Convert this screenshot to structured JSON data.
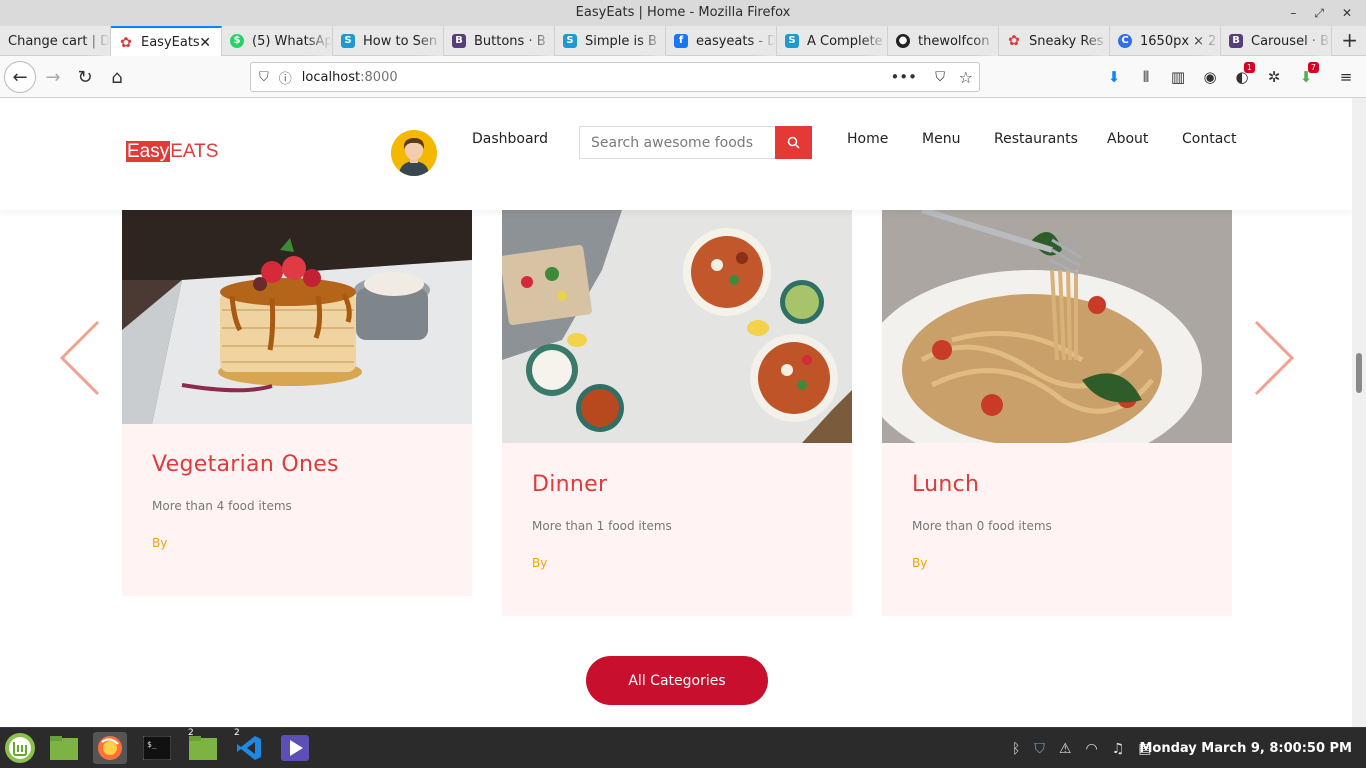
{
  "window": {
    "title": "EasyEats | Home - Mozilla Firefox"
  },
  "tabs": [
    {
      "label": "Change cart | D",
      "icon": "django-icon",
      "color": "#0c4b33"
    },
    {
      "label": "EasyEats",
      "icon": "easyeats-icon",
      "color": "#e03a3a",
      "active": true
    },
    {
      "label": "(5) WhatsAp",
      "icon": "whatsapp-icon",
      "color": "#25d366"
    },
    {
      "label": "How to Sen",
      "icon": "stackoverflow-icon",
      "color": "#1d9bd1"
    },
    {
      "label": "Buttons · B",
      "icon": "bootstrap-icon",
      "color": "#563d7c"
    },
    {
      "label": "Simple is B",
      "icon": "stackoverflow-icon",
      "color": "#1d9bd1"
    },
    {
      "label": "easyeats - D",
      "icon": "facebook-icon",
      "color": "#1877f2"
    },
    {
      "label": "A Complete",
      "icon": "stackoverflow-icon",
      "color": "#1d9bd1"
    },
    {
      "label": "thewolfcon",
      "icon": "github-icon",
      "color": "#222222"
    },
    {
      "label": "Sneaky Res",
      "icon": "easyeats-icon",
      "color": "#e03a3a"
    },
    {
      "label": "1650px × 2",
      "icon": "image-icon",
      "color": "#2f6fed"
    },
    {
      "label": "Carousel · B",
      "icon": "bootstrap-icon",
      "color": "#563d7c"
    }
  ],
  "nav": {
    "url_host": "localhost",
    "url_port": ":8000"
  },
  "toolbar_badges": {
    "notifications": "1",
    "downloads": "7"
  },
  "site": {
    "logo_easy": "Easy",
    "logo_eats": "EATS",
    "dashboard": "Dashboard",
    "search_placeholder": "Search awesome foods",
    "menu": [
      "Home",
      "Menu",
      "Restaurants",
      "About",
      "Contact"
    ],
    "brand_color": "#e03a3a",
    "cards": [
      {
        "title": "Vegetarian Ones",
        "count": "More than 4 food items",
        "by": "By"
      },
      {
        "title": "Dinner",
        "count": "More than 1 food items",
        "by": "By"
      },
      {
        "title": "Lunch",
        "count": "More than 0 food items",
        "by": "By"
      }
    ],
    "all_categories": "All Categories"
  },
  "taskbar": {
    "clock": "Monday March  9, 8:00:50 PM",
    "files_count": "2",
    "vscode_count": "2"
  }
}
